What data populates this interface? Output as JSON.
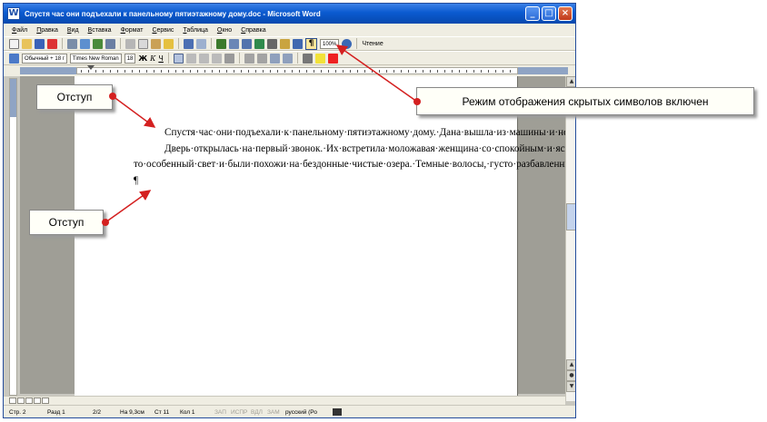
{
  "window": {
    "title": "Спустя час они подъехали к панельному пятиэтажному дому.doc - Microsoft Word",
    "app_icon": "W",
    "controls": [
      "minimize-icon",
      "maximize-icon",
      "close-icon"
    ]
  },
  "menu": [
    "Файл",
    "Правка",
    "Вид",
    "Вставка",
    "Формат",
    "Сервис",
    "Таблица",
    "Окно",
    "Справка"
  ],
  "toolbar": {
    "zoom": "100%",
    "reading": "Чтение",
    "pilcrow": "¶"
  },
  "format_bar": {
    "style": "Обычный + 18 г",
    "font": "Times New Roman",
    "size": "18",
    "bold": "Ж",
    "italic": "К",
    "underline": "Ч"
  },
  "document": {
    "paragraphs": [
      "Спустя·час·они·подъехали·к·панельному·пятиэтажному·дому.·Дана·вышла·из·машины·и·неторопливо·направилась·в·крайний·подъезд.·Костя·шел·за·ней.·Он·привычно·молчал·и,·похоже,·чувствовал·себя·неловко.¶",
      "Дверь·открылась·на·первый·звонок.·Их·встретила·моложавая·женщина·со·спокойным·и·ясным·лицом.·Ее·большие·синие·глаза·излучали·какой-то·особенный·свет·и·были·похожи·на·бездонные·чистые·озера.·Темные·волосы,·густо·разбавленные·серебряными·нитями,·были·гладко·зачесаны·и·собраны·на·затылке·в·большой·и·тугой·пучок.¶",
      "¶"
    ]
  },
  "status": {
    "page": "Стр. 2",
    "section": "Разд 1",
    "pages": "2/2",
    "position": "На 9,3см",
    "line": "Ст 11",
    "column": "Кол 1",
    "flags": [
      "ЗАП",
      "ИСПР",
      "ВДЛ",
      "ЗАМ"
    ],
    "language": "русский (Ро"
  },
  "callouts": {
    "indent_top": "Отступ",
    "indent_bottom": "Отступ",
    "hidden_symbols": "Режим отображения скрытых символов включен"
  },
  "colors": {
    "titlebar": "#0a5ad0",
    "arrow": "#d42020",
    "page_bg": "#ffffff",
    "workspace": "#9f9e96"
  }
}
